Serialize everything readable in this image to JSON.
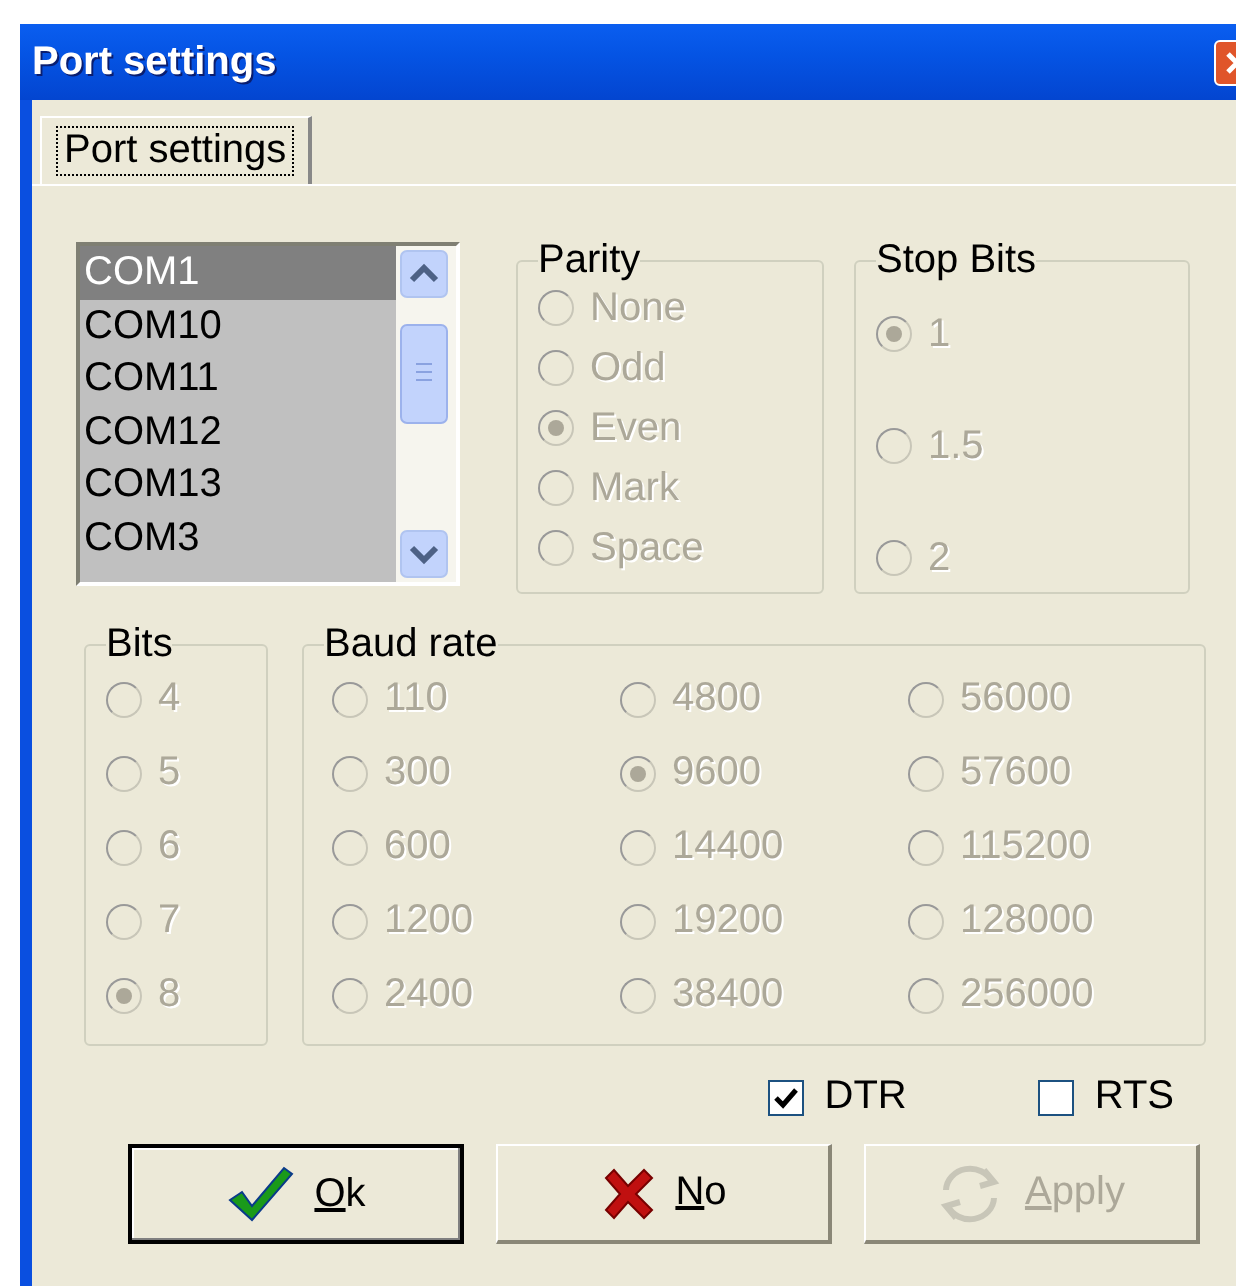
{
  "window": {
    "title": "Port settings"
  },
  "tabs": [
    {
      "label": "Port settings",
      "selected": true
    }
  ],
  "ports": {
    "items": [
      {
        "label": "COM1",
        "selected": true
      },
      {
        "label": "COM10",
        "selected": false
      },
      {
        "label": "COM11",
        "selected": false
      },
      {
        "label": "COM12",
        "selected": false
      },
      {
        "label": "COM13",
        "selected": false
      },
      {
        "label": "COM3",
        "selected": false
      }
    ]
  },
  "parity": {
    "title": "Parity",
    "disabled": true,
    "options": [
      {
        "label": "None",
        "selected": false
      },
      {
        "label": "Odd",
        "selected": false
      },
      {
        "label": "Even",
        "selected": true
      },
      {
        "label": "Mark",
        "selected": false
      },
      {
        "label": "Space",
        "selected": false
      }
    ]
  },
  "stop_bits": {
    "title": "Stop Bits",
    "disabled": true,
    "options": [
      {
        "label": "1",
        "selected": true
      },
      {
        "label": "1.5",
        "selected": false
      },
      {
        "label": "2",
        "selected": false
      }
    ]
  },
  "bits": {
    "title": "Bits",
    "disabled": true,
    "options": [
      {
        "label": "4",
        "selected": false
      },
      {
        "label": "5",
        "selected": false
      },
      {
        "label": "6",
        "selected": false
      },
      {
        "label": "7",
        "selected": false
      },
      {
        "label": "8",
        "selected": true
      }
    ]
  },
  "baud_rate": {
    "title": "Baud rate",
    "disabled": true,
    "options": [
      {
        "label": "110",
        "selected": false
      },
      {
        "label": "300",
        "selected": false
      },
      {
        "label": "600",
        "selected": false
      },
      {
        "label": "1200",
        "selected": false
      },
      {
        "label": "2400",
        "selected": false
      },
      {
        "label": "4800",
        "selected": false
      },
      {
        "label": "9600",
        "selected": true
      },
      {
        "label": "14400",
        "selected": false
      },
      {
        "label": "19200",
        "selected": false
      },
      {
        "label": "38400",
        "selected": false
      },
      {
        "label": "56000",
        "selected": false
      },
      {
        "label": "57600",
        "selected": false
      },
      {
        "label": "115200",
        "selected": false
      },
      {
        "label": "128000",
        "selected": false
      },
      {
        "label": "256000",
        "selected": false
      }
    ]
  },
  "checkboxes": [
    {
      "label": "DTR",
      "checked": true
    },
    {
      "label": "RTS",
      "checked": false
    }
  ],
  "buttons": [
    {
      "kind": "ok",
      "label": "Ok",
      "disabled": false,
      "default": true
    },
    {
      "kind": "no",
      "label": "No",
      "disabled": false,
      "default": false
    },
    {
      "kind": "apply",
      "label": "Apply",
      "disabled": true,
      "default": false
    }
  ]
}
